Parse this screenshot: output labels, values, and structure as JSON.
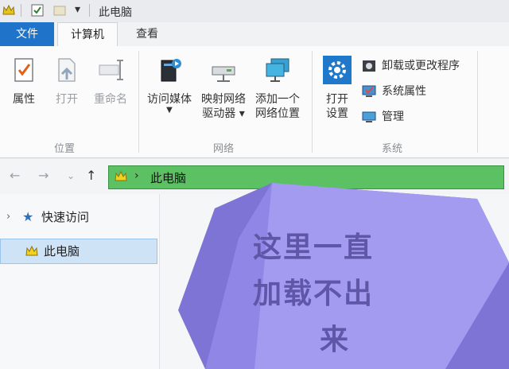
{
  "window": {
    "title": "此电脑"
  },
  "tabs": {
    "file": "文件",
    "computer": "计算机",
    "view": "查看"
  },
  "ribbon": {
    "location": {
      "label": "位置",
      "properties": "属性",
      "open": "打开",
      "rename": "重命名"
    },
    "network": {
      "label": "网络",
      "access_media": "访问媒体",
      "map_drive_line1": "映射网络",
      "map_drive_line2": "驱动器",
      "add_location_line1": "添加一个",
      "add_location_line2": "网络位置"
    },
    "system": {
      "label": "系统",
      "open_settings_line1": "打开",
      "open_settings_line2": "设置",
      "uninstall": "卸载或更改程序",
      "system_properties": "系统属性",
      "manage": "管理"
    }
  },
  "address": {
    "path": "此电脑"
  },
  "nav": {
    "quick_access": "快速访问",
    "this_pc": "此电脑"
  },
  "overlay": {
    "line1": "这里一直",
    "line2": "加载不出",
    "line3": "来"
  },
  "colors": {
    "file_tab": "#1f73c8",
    "address_bar": "#5cc163",
    "overlay_light": "#a39bf0",
    "overlay_dark": "#7e74d6"
  }
}
